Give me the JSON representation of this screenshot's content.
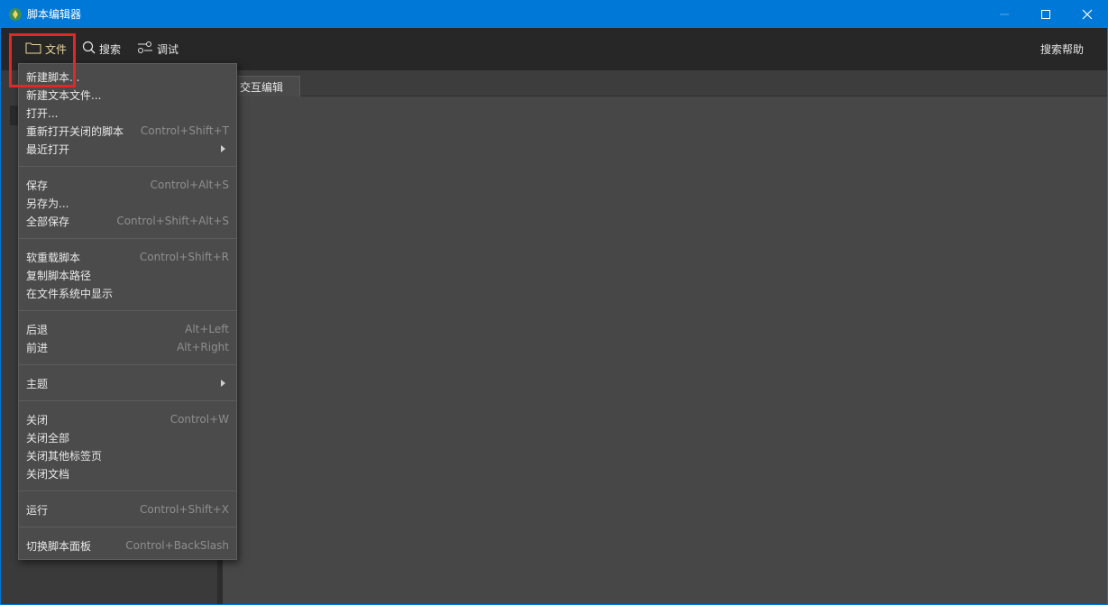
{
  "window": {
    "title": "脚本编辑器",
    "title_bar_color": "#0078d7"
  },
  "menubar": {
    "file": "文件",
    "search": "搜索",
    "debug": "调试",
    "help": "搜索帮助",
    "file_color": "#e8d49a",
    "highlight_color": "#e02828"
  },
  "tabs": [
    "交互编辑"
  ],
  "file_menu": {
    "items": [
      {
        "label": "新建脚本...",
        "shortcut": ""
      },
      {
        "label": "新建文本文件...",
        "shortcut": ""
      },
      {
        "label": "打开...",
        "shortcut": ""
      },
      {
        "label": "重新打开关闭的脚本",
        "shortcut": "Control+Shift+T"
      },
      {
        "label": "最近打开",
        "shortcut": "",
        "submenu": true
      },
      {
        "label": "保存",
        "shortcut": "Control+Alt+S"
      },
      {
        "label": "另存为...",
        "shortcut": ""
      },
      {
        "label": "全部保存",
        "shortcut": "Control+Shift+Alt+S"
      },
      {
        "label": "软重载脚本",
        "shortcut": "Control+Shift+R"
      },
      {
        "label": "复制脚本路径",
        "shortcut": ""
      },
      {
        "label": "在文件系统中显示",
        "shortcut": ""
      },
      {
        "label": "后退",
        "shortcut": "Alt+Left"
      },
      {
        "label": "前进",
        "shortcut": "Alt+Right"
      },
      {
        "label": "主题",
        "shortcut": "",
        "submenu": true
      },
      {
        "label": "关闭",
        "shortcut": "Control+W"
      },
      {
        "label": "关闭全部",
        "shortcut": ""
      },
      {
        "label": "关闭其他标签页",
        "shortcut": ""
      },
      {
        "label": "关闭文档",
        "shortcut": ""
      },
      {
        "label": "运行",
        "shortcut": "Control+Shift+X"
      },
      {
        "label": "切换脚本面板",
        "shortcut": "Control+BackSlash"
      }
    ]
  }
}
